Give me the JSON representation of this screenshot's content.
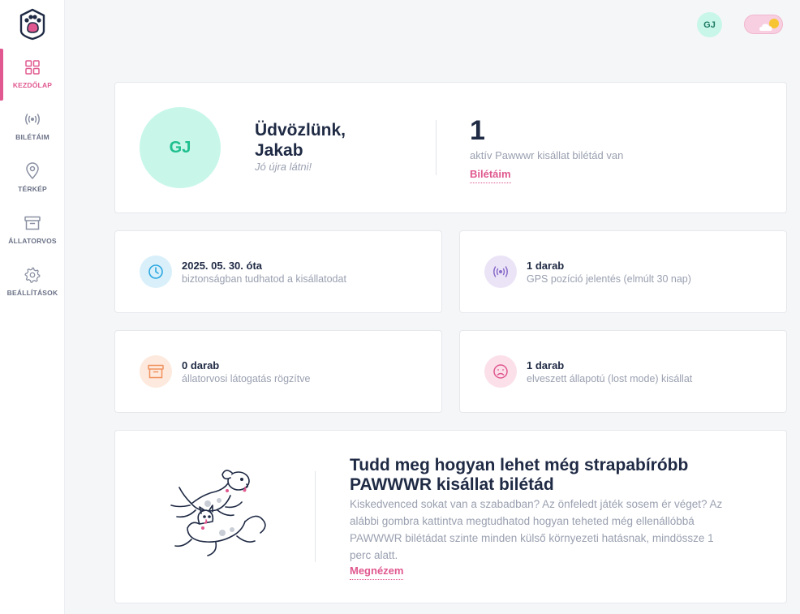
{
  "sidebar": {
    "logo": "paw-logo",
    "items": [
      {
        "label": "KEZDŐLAP",
        "icon": "dashboard-grid-icon",
        "active": true
      },
      {
        "label": "BILÉTÁIM",
        "icon": "signal-broadcast-icon",
        "active": false
      },
      {
        "label": "TÉRKÉP",
        "icon": "map-pin-icon",
        "active": false
      },
      {
        "label": "ÁLLATORVOS",
        "icon": "archive-box-icon",
        "active": false
      },
      {
        "label": "BEÁLLÍTÁSOK",
        "icon": "gear-icon",
        "active": false
      }
    ]
  },
  "header": {
    "avatar_initials": "GJ",
    "theme_toggle_icon": "sun-cloud-icon"
  },
  "welcome": {
    "avatar_initials": "GJ",
    "title": "Üdvözlünk, Jakab",
    "subtitle": "Jó újra látni!",
    "count": "1",
    "count_text": "aktív Pawwwr kisállat bilétád van",
    "link": "Bilétáim"
  },
  "stats": [
    {
      "title": "2025. 05. 30. óta",
      "desc": "biztonságban tudhatod a kisállatodat",
      "icon": "clock-icon",
      "color": "#2aa7e0",
      "bg": "#d9f0fb"
    },
    {
      "title": "1 darab",
      "desc": "GPS pozíció jelentés (elmúlt 30 nap)",
      "icon": "signal-broadcast-icon",
      "color": "#8a6cc9",
      "bg": "#ebe4f7"
    },
    {
      "title": "0 darab",
      "desc": "állatorvosi látogatás rögzítve",
      "icon": "archive-box-icon",
      "color": "#f0925f",
      "bg": "#fde9dd"
    },
    {
      "title": "1 darab",
      "desc": "elveszett állapotú (lost mode) kisállat",
      "icon": "sad-face-icon",
      "color": "#e0588f",
      "bg": "#fbe0ea"
    }
  ],
  "promo": {
    "title": "Tudd meg hogyan lehet még strapabíróbb PAWWWR kisállat bilétád",
    "text": "Kiskedvenced sokat van a szabadban? Az önfeledt játék sosem ér véget? Az alábbi gombra kattintva megtudhatod hogyan teheted még ellenállóbbá PAWWWR bilétádat szinte minden külső környezeti hatásnak, mindössze 1 perc alatt.",
    "link": "Megnézem",
    "illustration": "dog-and-cat-illustration"
  },
  "colors": {
    "accent": "#e0588f",
    "mint": "#c8f7ea",
    "text_dark": "#1f2a44",
    "text_muted": "#9aa0b0"
  }
}
